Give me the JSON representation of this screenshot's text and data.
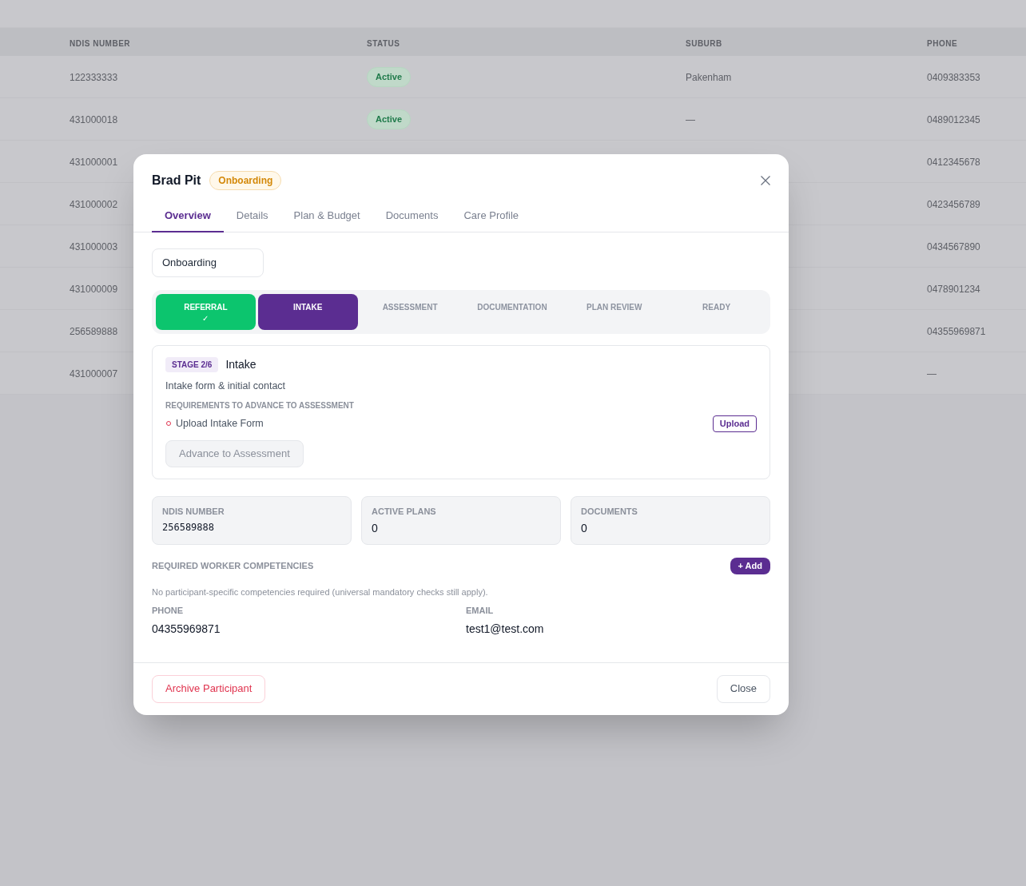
{
  "background_table": {
    "columns": [
      "NDIS NUMBER",
      "STATUS",
      "SUBURB",
      "PHONE"
    ],
    "rows": [
      {
        "ndis_number": "122333333",
        "status": "Active",
        "suburb": "Pakenham",
        "phone": "0409383353"
      },
      {
        "ndis_number": "431000018",
        "status": "Active",
        "suburb": "—",
        "phone": "0489012345"
      },
      {
        "ndis_number": "431000001",
        "phone": "0412345678"
      },
      {
        "ndis_number": "431000002",
        "phone": "0423456789"
      },
      {
        "ndis_number": "431000003",
        "phone": "0434567890"
      },
      {
        "ndis_number": "431000009",
        "phone": "0478901234"
      },
      {
        "ndis_number": "256589888",
        "phone": "04355969871"
      },
      {
        "ndis_number": "431000007",
        "phone": "—"
      }
    ]
  },
  "modal": {
    "title": "Brad Pit",
    "status_badge": "Onboarding",
    "tabs": [
      {
        "label": "Overview",
        "selected": true
      },
      {
        "label": "Details",
        "selected": false
      },
      {
        "label": "Plan & Budget",
        "selected": false
      },
      {
        "label": "Documents",
        "selected": false
      },
      {
        "label": "Care Profile",
        "selected": false
      }
    ],
    "stage_select": {
      "value": "Onboarding"
    },
    "stages": [
      {
        "label": "REFERRAL",
        "completed": true,
        "selected": false,
        "mark": "✓"
      },
      {
        "label": "INTAKE",
        "completed": false,
        "selected": true
      },
      {
        "label": "ASSESSMENT",
        "completed": false,
        "selected": false
      },
      {
        "label": "DOCUMENTATION",
        "completed": false,
        "selected": false
      },
      {
        "label": "PLAN REVIEW",
        "completed": false,
        "selected": false
      },
      {
        "label": "READY",
        "completed": false,
        "selected": false
      }
    ],
    "stage_card": {
      "badge": "STAGE 2/6",
      "title": "Intake",
      "description": "Intake form & initial contact",
      "requirements_heading": "REQUIREMENTS TO ADVANCE TO ASSESSMENT",
      "requirements": [
        {
          "label": "Upload Intake Form",
          "met": false,
          "action": "Upload"
        }
      ],
      "advance_button": {
        "label": "Advance to Assessment",
        "disabled": true
      }
    },
    "stats": [
      {
        "label": "NDIS NUMBER",
        "value": "256589888",
        "kind": "code"
      },
      {
        "label": "ACTIVE PLANS",
        "value": "0",
        "kind": "count"
      },
      {
        "label": "DOCUMENTS",
        "value": "0",
        "kind": "count"
      }
    ],
    "competencies": {
      "heading": "REQUIRED WORKER COMPETENCIES",
      "add_button": "+ Add",
      "empty_text": "No participant-specific competencies required (universal mandatory checks still apply)."
    },
    "contact": [
      {
        "label": "PHONE",
        "value": "04355969871"
      },
      {
        "label": "EMAIL",
        "value": "test1@test.com"
      }
    ],
    "footer": {
      "archive_button": "Archive Participant",
      "close_button": "Close"
    }
  }
}
